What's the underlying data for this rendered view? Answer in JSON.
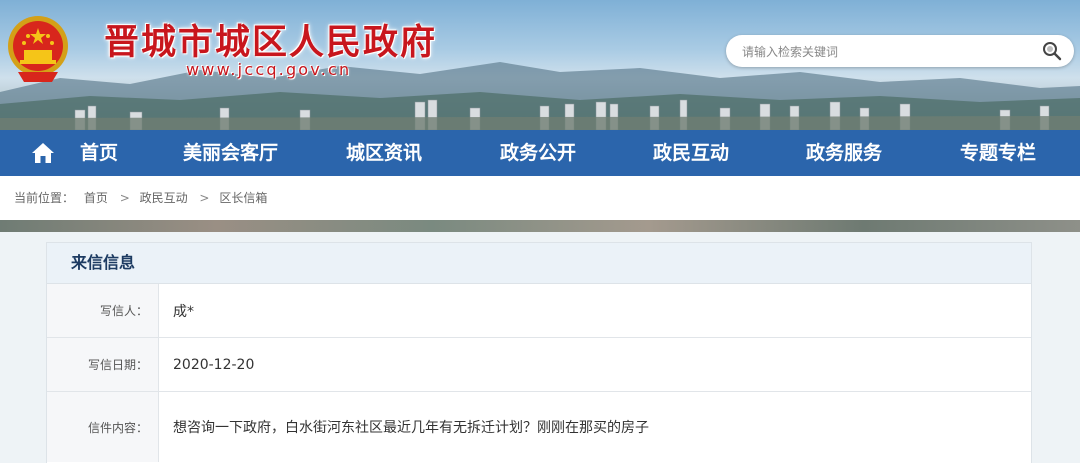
{
  "header": {
    "site_title": "晋城市城区人民政府",
    "site_url": "www.jccq.gov.cn",
    "search": {
      "placeholder": "请输入检索关键词"
    }
  },
  "nav": {
    "items": [
      {
        "label": "首页"
      },
      {
        "label": "美丽会客厅"
      },
      {
        "label": "城区资讯"
      },
      {
        "label": "政务公开"
      },
      {
        "label": "政民互动"
      },
      {
        "label": "政务服务"
      },
      {
        "label": "专题专栏"
      }
    ]
  },
  "breadcrumb": {
    "prefix": "当前位置：",
    "items": [
      "首页",
      "政民互动",
      "区长信箱"
    ],
    "separator": ">"
  },
  "letter": {
    "section_title": "来信信息",
    "fields": [
      {
        "label": "写信人：",
        "value": "成*"
      },
      {
        "label": "写信日期：",
        "value": "2020-12-20"
      },
      {
        "label": "信件内容：",
        "value": "想咨询一下政府，白水街河东社区最近几年有无拆迁计划？刚刚在那买的房子"
      }
    ]
  },
  "colors": {
    "nav_bg": "#2b65ac",
    "title_red": "#c8161d",
    "card_head_bg": "#ebf2f8"
  }
}
